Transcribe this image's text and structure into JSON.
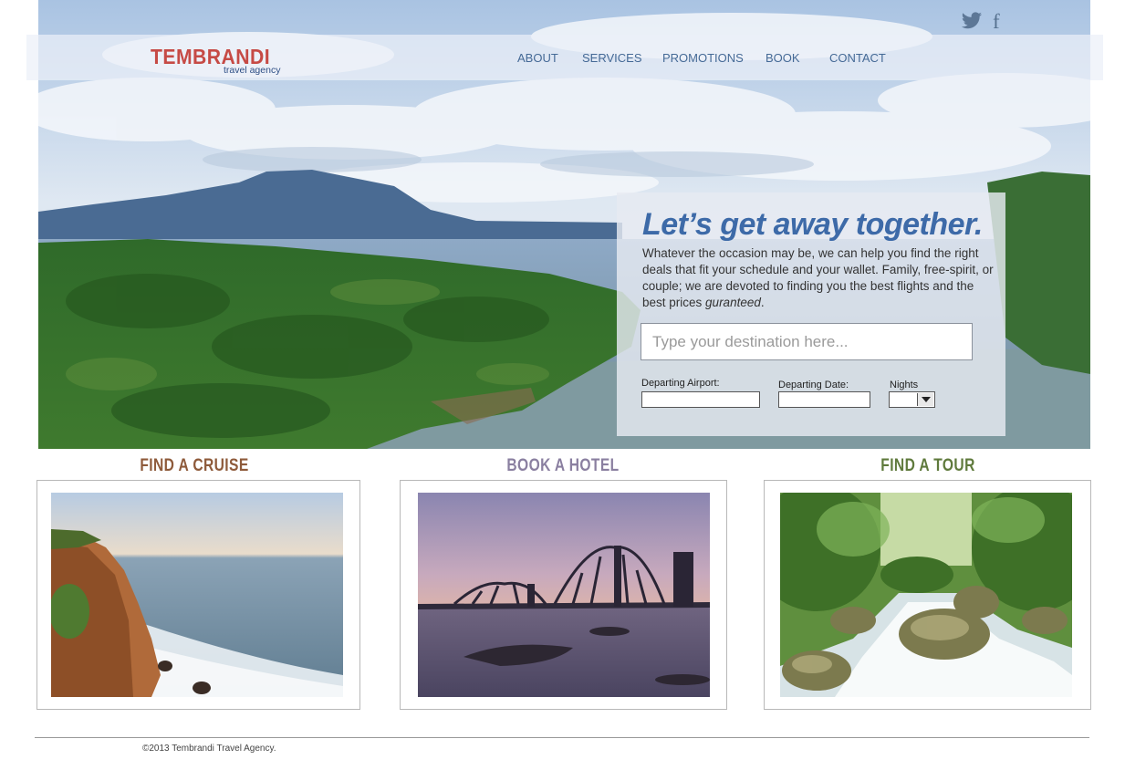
{
  "brand": {
    "name": "TEMBRANDI",
    "tagline": "travel agency"
  },
  "nav": {
    "items": [
      {
        "label": "ABOUT"
      },
      {
        "label": "SERVICES"
      },
      {
        "label": "PROMOTIONS"
      },
      {
        "label": "BOOK"
      },
      {
        "label": "CONTACT"
      }
    ]
  },
  "social": {
    "twitter_icon": "twitter-bird-icon",
    "facebook_glyph": "f"
  },
  "promo": {
    "title": "Let’s get away together.",
    "body": "Whatever the occasion may be, we can help you find the right deals that fit your schedule and your wallet. Family, free-spirit, or couple; we are devoted to finding you the best flights and the best prices",
    "body_emphasis": "guranteed",
    "body_end": ".",
    "destination_placeholder": "Type your destination here...",
    "departing_airport_label": "Departing Airport:",
    "departing_date_label": "Departing Date:",
    "nights_label": "Nights",
    "nights_value": ""
  },
  "cards": [
    {
      "title": "FIND A CRUISE",
      "color": "#8e5a3a",
      "image": "sea-cliff-photo"
    },
    {
      "title": "BOOK A HOTEL",
      "color": "#8a7fa0",
      "image": "bridge-sunset-photo"
    },
    {
      "title": "FIND A TOUR",
      "color": "#5f7a3c",
      "image": "forest-stream-photo"
    }
  ],
  "footer": {
    "copyright": "©2013 Tembrandi Travel Agency."
  }
}
